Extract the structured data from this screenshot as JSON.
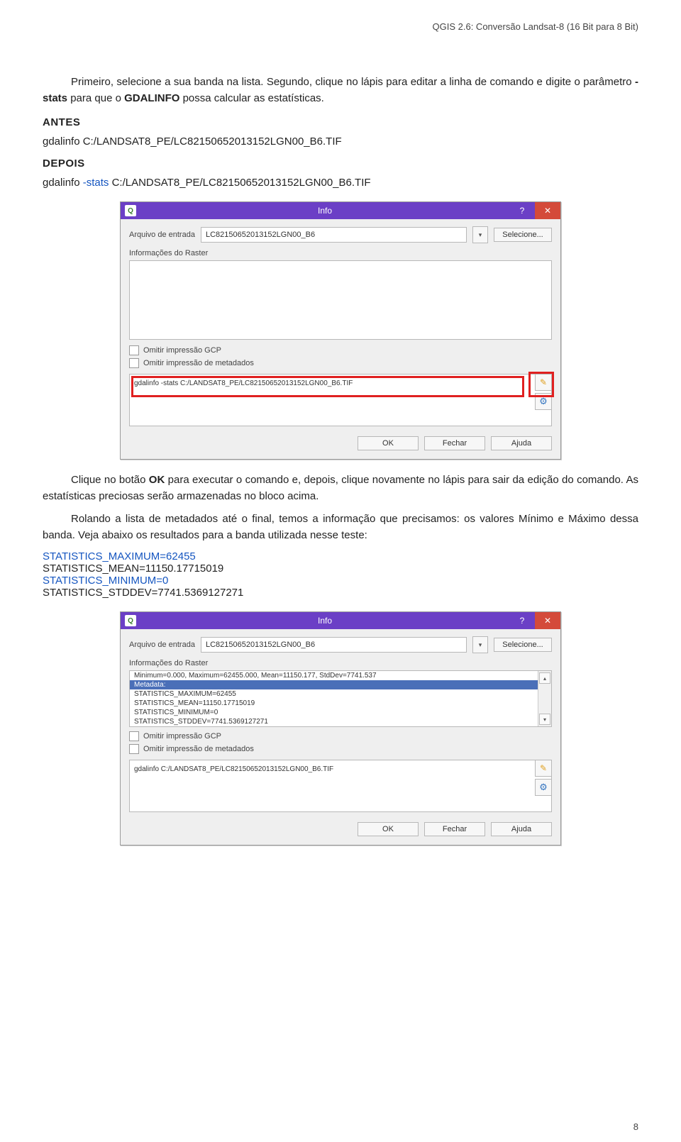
{
  "header": "QGIS 2.6: Conversão Landsat-8 (16 Bit para 8 Bit)",
  "p1a": "Primeiro, selecione a sua banda na lista. Segundo, clique no lápis para editar a linha de comando e digite o parâmetro ",
  "p1_stats": "-stats",
  "p1b": " para que o ",
  "p1_gdalinfo": "GDALINFO",
  "p1c": " possa calcular as estatísticas.",
  "antes": "ANTES",
  "cmd_before": "gdalinfo C:/LANDSAT8_PE/LC82150652013152LGN00_B6.TIF",
  "depois": "DEPOIS",
  "cmd_after_a": "gdalinfo ",
  "cmd_after_b": "-stats",
  "cmd_after_c": " C:/LANDSAT8_PE/LC82150652013152LGN00_B6.TIF",
  "dlg1": {
    "title": "Info",
    "input_label": "Arquivo de entrada",
    "input_value": "LC82150652013152LGN00_B6",
    "select_btn": "Selecione...",
    "info_label": "Informações do Raster",
    "omit_gcp": "Omitir impressão GCP",
    "omit_meta": "Omitir impressão de metadados",
    "cmd": "gdalinfo -stats C:/LANDSAT8_PE/LC82150652013152LGN00_B6.TIF",
    "ok": "OK",
    "close": "Fechar",
    "help": "Ajuda"
  },
  "p2a": "Clique no botão ",
  "p2_ok": "OK",
  "p2b": " para executar o comando e, depois, clique novamente no lápis para sair da edição do comando. As estatísticas preciosas serão armazenadas no bloco acima.",
  "p3": "Rolando a lista de metadados até o final, temos a informação que precisamos: os valores Mínimo e Máximo dessa banda. Veja abaixo os resultados para a banda utilizada nesse teste:",
  "stat_max": "STATISTICS_MAXIMUM=62455",
  "stat_mean": "STATISTICS_MEAN=11150.17715019",
  "stat_min": "STATISTICS_MINIMUM=0",
  "stat_std": "STATISTICS_STDDEV=7741.5369127271",
  "dlg2": {
    "title": "Info",
    "input_label": "Arquivo de entrada",
    "input_value": "LC82150652013152LGN00_B6",
    "select_btn": "Selecione...",
    "info_label": "Informações do Raster",
    "line_summary": "Minimum=0.000, Maximum=62455.000, Mean=11150.177, StdDev=7741.537",
    "line_meta": "Metadata:",
    "line_max": "  STATISTICS_MAXIMUM=62455",
    "line_mean": "  STATISTICS_MEAN=11150.17715019",
    "line_min": "  STATISTICS_MINIMUM=0",
    "line_std": "  STATISTICS_STDDEV=7741.5369127271",
    "omit_gcp": "Omitir impressão GCP",
    "omit_meta": "Omitir impressão de metadados",
    "cmd": "gdalinfo C:/LANDSAT8_PE/LC82150652013152LGN00_B6.TIF",
    "ok": "OK",
    "close": "Fechar",
    "help": "Ajuda"
  },
  "chart_data": {
    "type": "table",
    "title": "Band statistics",
    "series": [
      {
        "name": "STATISTICS_MAXIMUM",
        "values": [
          62455
        ]
      },
      {
        "name": "STATISTICS_MEAN",
        "values": [
          11150.17715019
        ]
      },
      {
        "name": "STATISTICS_MINIMUM",
        "values": [
          0
        ]
      },
      {
        "name": "STATISTICS_STDDEV",
        "values": [
          7741.5369127271
        ]
      }
    ]
  },
  "page_num": "8"
}
